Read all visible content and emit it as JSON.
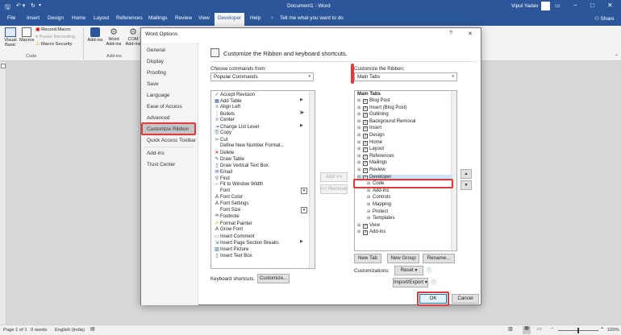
{
  "app": {
    "title": "Document1 - Word",
    "user": "Vipul Yadav",
    "share": "Share"
  },
  "menu": [
    "File",
    "Insert",
    "Design",
    "Home",
    "Layout",
    "References",
    "Mailings",
    "Review",
    "View",
    "Developer",
    "Help"
  ],
  "tellme": "Tell me what you want to do",
  "ribbon": {
    "visual_basic": "Visual Basic",
    "macros": "Macros",
    "record_macro": "Record Macro",
    "pause_recording": "Pause Recording",
    "macro_security": "Macro Security",
    "addins": "Add-ins",
    "word_addins": "Word Add-ins",
    "com_addins": "COM Add-ins",
    "group_code": "Code",
    "group_addins": "Add-ins"
  },
  "dialog": {
    "title": "Word Options",
    "help": "?",
    "close": "✕",
    "nav": [
      "General",
      "Display",
      "Proofing",
      "Save",
      "Language",
      "Ease of Access",
      "Advanced",
      "Customize Ribbon",
      "Quick Access Toolbar",
      "Add-ins",
      "Trust Center"
    ],
    "heading": "Customize the Ribbon and keyboard shortcuts.",
    "choose_label": "Choose commands from:",
    "choose_value": "Popular Commands",
    "customize_label": "Customize the Ribbon:",
    "customize_value": "Main Tabs",
    "commands": [
      "Accept Revision",
      "Add Table",
      "Align Left",
      "Bullets",
      "Center",
      "Change List Level",
      "Copy",
      "Cut",
      "Define New Number Format...",
      "Delete",
      "Draw Table",
      "Draw Vertical Text Box",
      "Email",
      "Find",
      "Fit to Window Width",
      "Font",
      "Font Color",
      "Font Settings",
      "Font Size",
      "Footnote",
      "Format Painter",
      "Grow Font",
      "Insert Comment",
      "Insert Page Section Breaks",
      "Insert Picture",
      "Insert Text Box"
    ],
    "tabs_header": "Main Tabs",
    "tabs": [
      {
        "label": "Blog Post",
        "indent": 0,
        "check": true
      },
      {
        "label": "Insert (Blog Post)",
        "indent": 0,
        "check": true
      },
      {
        "label": "Outlining",
        "indent": 0,
        "check": true
      },
      {
        "label": "Background Removal",
        "indent": 0,
        "check": true
      },
      {
        "label": "Insert",
        "indent": 0,
        "check": true
      },
      {
        "label": "Design",
        "indent": 0,
        "check": true
      },
      {
        "label": "Home",
        "indent": 0,
        "check": true
      },
      {
        "label": "Layout",
        "indent": 0,
        "check": true
      },
      {
        "label": "References",
        "indent": 0,
        "check": true
      },
      {
        "label": "Mailings",
        "indent": 0,
        "check": true
      },
      {
        "label": "Review",
        "indent": 0,
        "check": true
      },
      {
        "label": "Developer",
        "indent": 0,
        "check": true
      },
      {
        "label": "Code",
        "indent": 1,
        "check": false
      },
      {
        "label": "Add-ins",
        "indent": 1,
        "check": false
      },
      {
        "label": "Controls",
        "indent": 1,
        "check": false
      },
      {
        "label": "Mapping",
        "indent": 1,
        "check": false
      },
      {
        "label": "Protect",
        "indent": 1,
        "check": false
      },
      {
        "label": "Templates",
        "indent": 1,
        "check": false
      },
      {
        "label": "View",
        "indent": 0,
        "check": true
      },
      {
        "label": "Add-ins",
        "indent": 0,
        "check": true
      }
    ],
    "add": "Add >>",
    "remove": "<< Remove",
    "new_tab": "New Tab",
    "new_group": "New Group",
    "rename": "Rename...",
    "customizations": "Customizations:",
    "reset": "Reset ▾",
    "import_export": "Import/Export ▾",
    "kb_label": "Keyboard shortcuts:",
    "kb_button": "Customize...",
    "ok": "OK",
    "cancel": "Cancel"
  },
  "status": {
    "page": "Page 1 of 1",
    "words": "0 words",
    "lang": "English (India)",
    "zoom": "100%"
  },
  "colors": {
    "accent": "#2b579a",
    "highlight": "#e03a3a"
  }
}
